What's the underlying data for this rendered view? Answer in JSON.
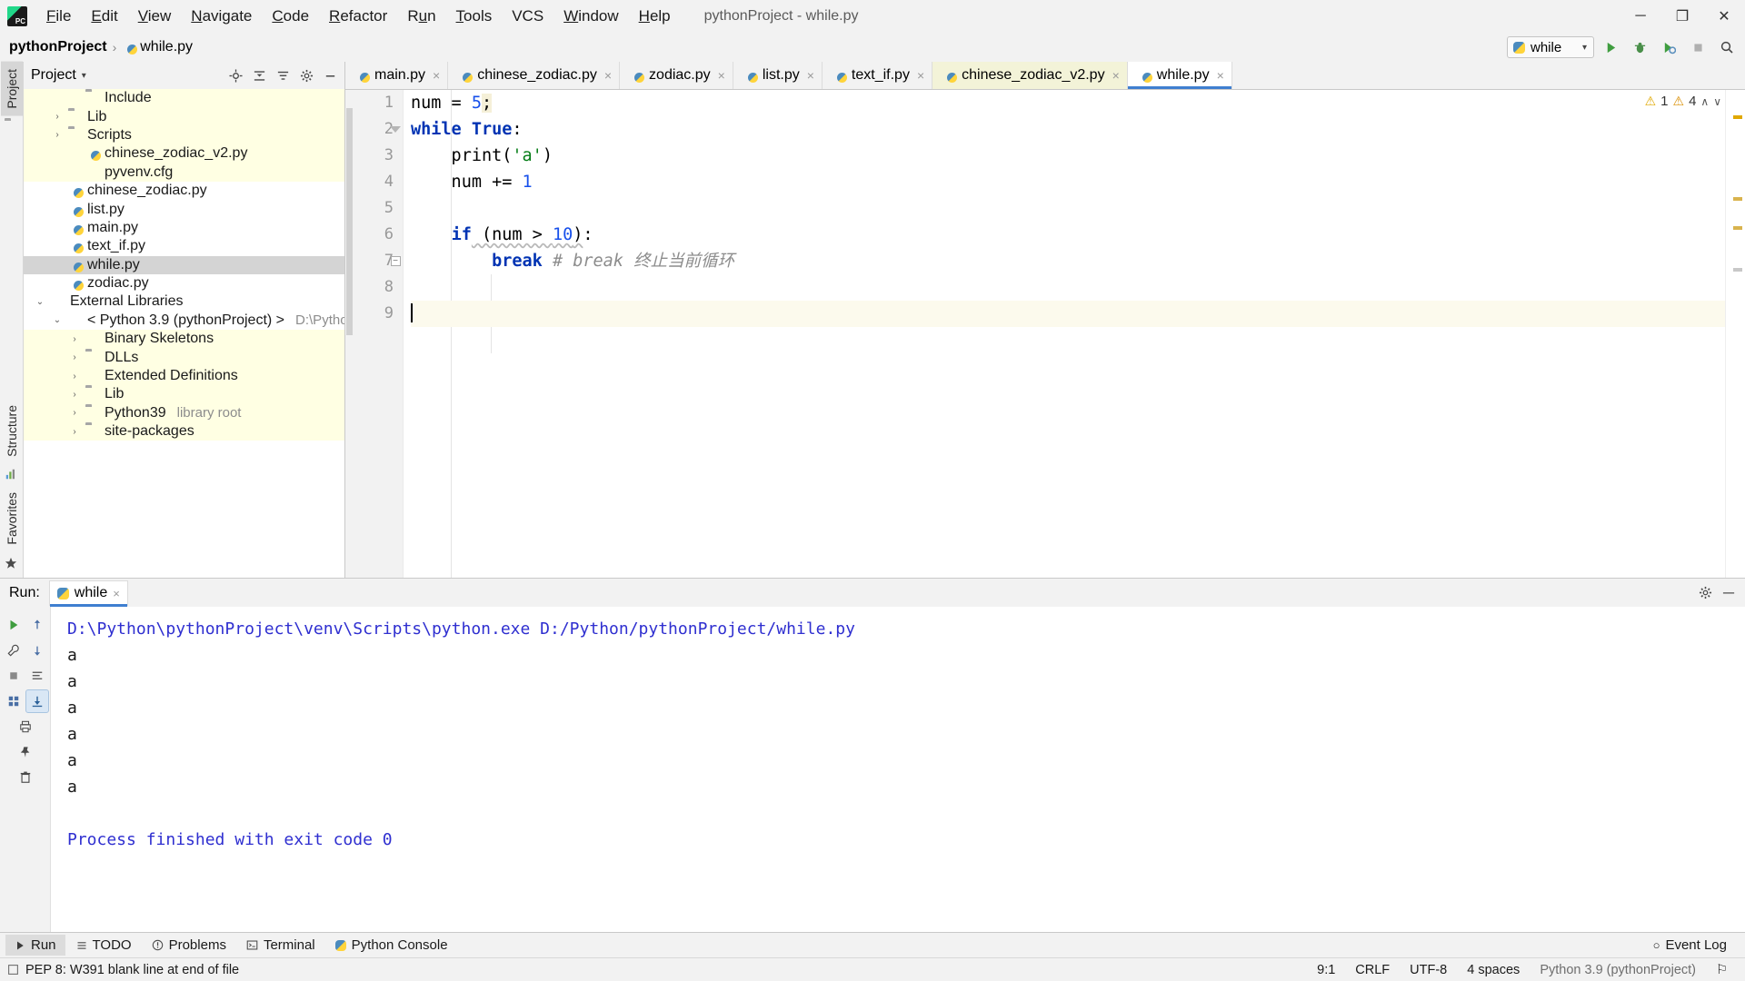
{
  "titlebar": {
    "logo": "pycharm-logo",
    "menus": [
      "File",
      "Edit",
      "View",
      "Navigate",
      "Code",
      "Refactor",
      "Run",
      "Tools",
      "VCS",
      "Window",
      "Help"
    ],
    "window_title": "pythonProject - while.py",
    "minimize": "─",
    "maximize": "❐",
    "close": "✕"
  },
  "navbar": {
    "project": "pythonProject",
    "separator": "›",
    "file": "while.py",
    "run_config": "while",
    "run_config_caret": "▾",
    "buttons": [
      "run-button",
      "debug-button",
      "coverage-button",
      "stop-button",
      "search-everywhere-button"
    ]
  },
  "project_panel": {
    "title": "Project",
    "caret": "▾",
    "tools": [
      "locate-icon",
      "collapse-all-icon",
      "expand-icon",
      "settings-icon",
      "hide-icon"
    ],
    "tree": [
      {
        "indent": 2,
        "twisty": "",
        "icon": "folder",
        "label": "Include",
        "sub": "",
        "state": "hl"
      },
      {
        "indent": 1,
        "twisty": "›",
        "icon": "folder",
        "label": "Lib",
        "sub": "",
        "state": "hl"
      },
      {
        "indent": 1,
        "twisty": "›",
        "icon": "folder",
        "label": "Scripts",
        "sub": "",
        "state": "hl"
      },
      {
        "indent": 2,
        "twisty": "",
        "icon": "py",
        "label": "chinese_zodiac_v2.py",
        "sub": "",
        "state": "hl"
      },
      {
        "indent": 2,
        "twisty": "",
        "icon": "cfg",
        "label": "pyvenv.cfg",
        "sub": "",
        "state": "hl"
      },
      {
        "indent": 1,
        "twisty": "",
        "icon": "py",
        "label": "chinese_zodiac.py",
        "sub": "",
        "state": ""
      },
      {
        "indent": 1,
        "twisty": "",
        "icon": "py",
        "label": "list.py",
        "sub": "",
        "state": ""
      },
      {
        "indent": 1,
        "twisty": "",
        "icon": "py",
        "label": "main.py",
        "sub": "",
        "state": ""
      },
      {
        "indent": 1,
        "twisty": "",
        "icon": "py",
        "label": "text_if.py",
        "sub": "",
        "state": ""
      },
      {
        "indent": 1,
        "twisty": "",
        "icon": "py",
        "label": "while.py",
        "sub": "",
        "state": "sel"
      },
      {
        "indent": 1,
        "twisty": "",
        "icon": "py",
        "label": "zodiac.py",
        "sub": "",
        "state": ""
      },
      {
        "indent": 0,
        "twisty": "⌄",
        "icon": "lib",
        "label": "External Libraries",
        "sub": "",
        "state": ""
      },
      {
        "indent": 1,
        "twisty": "⌄",
        "icon": "pysnake",
        "label": "< Python 3.9 (pythonProject) >",
        "sub": "D:\\Python\\python",
        "state": ""
      },
      {
        "indent": 2,
        "twisty": "›",
        "icon": "lib",
        "label": "Binary Skeletons",
        "sub": "",
        "state": "hl"
      },
      {
        "indent": 2,
        "twisty": "›",
        "icon": "folder",
        "label": "DLLs",
        "sub": "",
        "state": "hl"
      },
      {
        "indent": 2,
        "twisty": "›",
        "icon": "lib",
        "label": "Extended Definitions",
        "sub": "",
        "state": "hl"
      },
      {
        "indent": 2,
        "twisty": "›",
        "icon": "folder",
        "label": "Lib",
        "sub": "",
        "state": "hl"
      },
      {
        "indent": 2,
        "twisty": "›",
        "icon": "folder",
        "label": "Python39",
        "sub": "library root",
        "state": "hl"
      },
      {
        "indent": 2,
        "twisty": "›",
        "icon": "folder",
        "label": "site-packages",
        "sub": "",
        "state": "hl"
      }
    ]
  },
  "left_strip": {
    "tabs": [
      "Project",
      "Structure",
      "Favorites"
    ]
  },
  "editor": {
    "tabs": [
      {
        "label": "main.py",
        "state": ""
      },
      {
        "label": "chinese_zodiac.py",
        "state": ""
      },
      {
        "label": "zodiac.py",
        "state": ""
      },
      {
        "label": "list.py",
        "state": ""
      },
      {
        "label": "text_if.py",
        "state": ""
      },
      {
        "label": "chinese_zodiac_v2.py",
        "state": "modified"
      },
      {
        "label": "while.py",
        "state": "active"
      }
    ],
    "close_glyph": "×",
    "inspection": {
      "warning_count": "1",
      "error_count": "4",
      "warning_icon": "⚠",
      "error_icon": "⚠",
      "up_arrow": "∧",
      "down_arrow": "∨"
    },
    "line_numbers": [
      "1",
      "2",
      "3",
      "4",
      "5",
      "6",
      "7",
      "8",
      "9"
    ],
    "code_lines": [
      {
        "n": 1,
        "tokens": [
          {
            "t": "num = ",
            "c": "p"
          },
          {
            "t": "5",
            "c": "n"
          },
          {
            "t": ";",
            "c": "p hl"
          }
        ]
      },
      {
        "n": 2,
        "tokens": [
          {
            "t": "while",
            "c": "k"
          },
          {
            "t": " ",
            "c": "p"
          },
          {
            "t": "True",
            "c": "k"
          },
          {
            "t": ":",
            "c": "p"
          }
        ]
      },
      {
        "n": 3,
        "tokens": [
          {
            "t": "    print(",
            "c": "p"
          },
          {
            "t": "'a'",
            "c": "s"
          },
          {
            "t": ")",
            "c": "p"
          }
        ]
      },
      {
        "n": 4,
        "tokens": [
          {
            "t": "    num += ",
            "c": "p"
          },
          {
            "t": "1",
            "c": "n"
          }
        ]
      },
      {
        "n": 5,
        "tokens": []
      },
      {
        "n": 6,
        "tokens": [
          {
            "t": "    ",
            "c": "p"
          },
          {
            "t": "if",
            "c": "k"
          },
          {
            "t": " (num > ",
            "c": "p wave"
          },
          {
            "t": "10",
            "c": "n wave"
          },
          {
            "t": ")",
            "c": "p wave"
          },
          {
            "t": ":",
            "c": "p"
          }
        ]
      },
      {
        "n": 7,
        "tokens": [
          {
            "t": "        ",
            "c": "p"
          },
          {
            "t": "break",
            "c": "k"
          },
          {
            "t": " # break ",
            "c": "cm"
          },
          {
            "t": "终止当前循环",
            "c": "cm"
          }
        ]
      },
      {
        "n": 8,
        "tokens": []
      },
      {
        "n": 9,
        "tokens": [],
        "caret": true
      }
    ]
  },
  "run_panel": {
    "label": "Run:",
    "tab_label": "while",
    "tab_close": "×",
    "settings_icon": "⚙",
    "minimize_icon": "─",
    "toolbar": [
      "rerun-button",
      "up-stack-button",
      "wrench-button",
      "down-stack-button",
      "stop-button",
      "soft-wrap-button",
      "grid-button",
      "scroll-to-end-button",
      "print-button",
      "pin-button",
      "trash-button"
    ],
    "console_lines": [
      {
        "text": "D:\\Python\\pythonProject\\venv\\Scripts\\python.exe D:/Python/pythonProject/while.py",
        "kind": "link"
      },
      {
        "text": "a",
        "kind": "out"
      },
      {
        "text": "a",
        "kind": "out"
      },
      {
        "text": "a",
        "kind": "out"
      },
      {
        "text": "a",
        "kind": "out"
      },
      {
        "text": "a",
        "kind": "out"
      },
      {
        "text": "a",
        "kind": "out"
      },
      {
        "text": "",
        "kind": "out"
      },
      {
        "text": "Process finished with exit code 0",
        "kind": "done"
      }
    ]
  },
  "toolwindow_bar": {
    "items": [
      {
        "label": "Run",
        "icon": "play-icon",
        "active": true
      },
      {
        "label": "TODO",
        "icon": "todo-icon",
        "active": false
      },
      {
        "label": "Problems",
        "icon": "problems-icon",
        "active": false
      },
      {
        "label": "Terminal",
        "icon": "terminal-icon",
        "active": false
      },
      {
        "label": "Python Console",
        "icon": "python-icon",
        "active": false
      }
    ],
    "event_log": "Event Log",
    "event_log_icon": "○"
  },
  "statusbar": {
    "message": "PEP 8: W391 blank line at end of file",
    "caret_position": "9:1",
    "line_separator": "CRLF",
    "encoding": "UTF-8",
    "indent": "4 spaces",
    "interpreter": "Python 3.9 (pythonProject)",
    "lock_icon": "⚐"
  },
  "colors": {
    "accent_blue": "#3f7fd0",
    "keyword": "#0033b3",
    "number": "#1750eb",
    "string": "#067d17",
    "comment": "#8c8c8c",
    "tab_modified_bg": "#f3f3d8",
    "tree_highlight": "#ffffe3",
    "tree_selected": "#d4d4d4",
    "console_link": "#2f2fd0"
  }
}
